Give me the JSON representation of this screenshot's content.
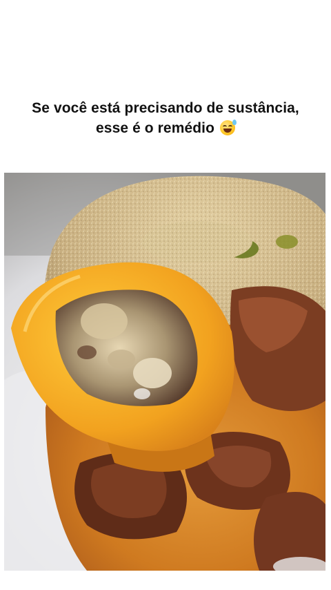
{
  "post": {
    "caption_line1": "Se você está precisando de sustância,",
    "caption_line2": "esse é o remédio",
    "emoji": "grinning-face-with-sweat"
  },
  "photo": {
    "subject": "food-photo"
  }
}
